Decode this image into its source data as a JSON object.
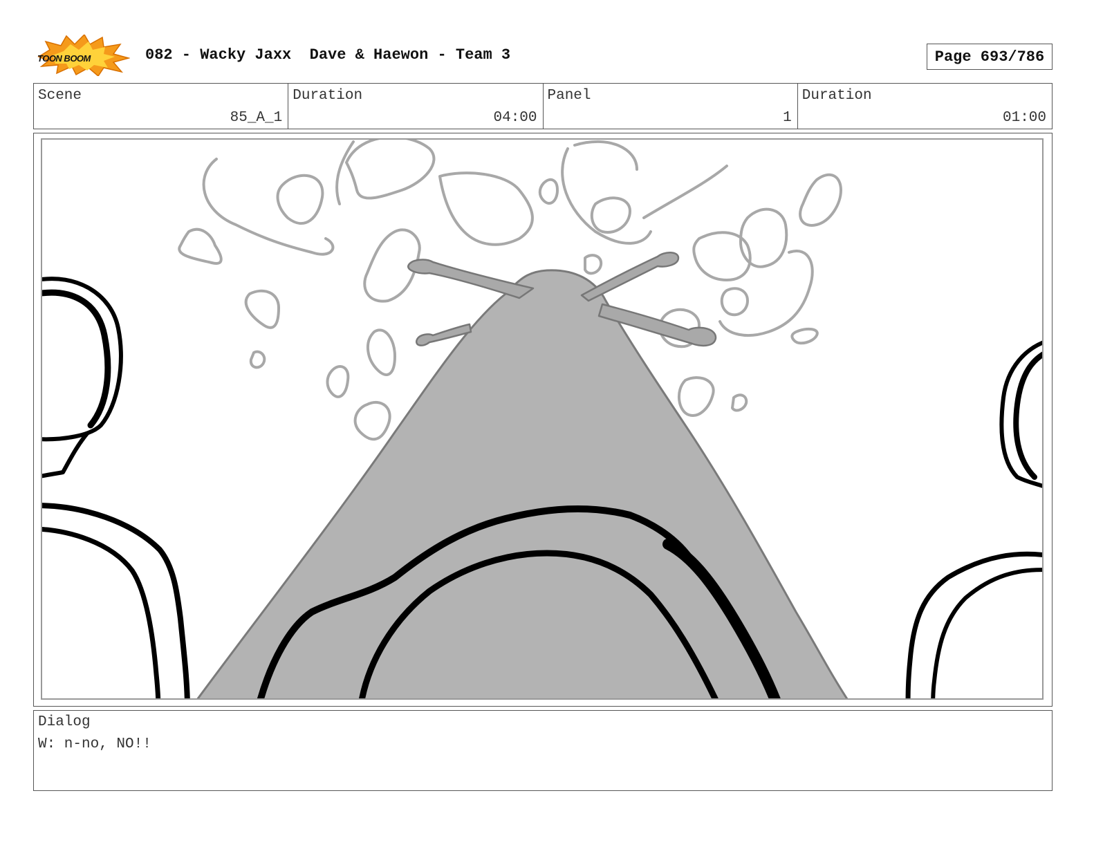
{
  "header": {
    "logo_text": "TOON BOOM",
    "title": "082 - Wacky Jaxx  Dave & Haewon - Team 3",
    "page": "Page 693/786"
  },
  "info": {
    "scene_label": "Scene",
    "scene_value": "85_A_1",
    "duration_label": "Duration",
    "duration_value": "04:00",
    "panel_label": "Panel",
    "panel_value": "1",
    "panel_duration_label": "Duration",
    "panel_duration_value": "01:00"
  },
  "dialog": {
    "label": "Dialog",
    "text": "W: n-no, NO!!"
  },
  "colors": {
    "border": "#555555",
    "frame_inner": "#999999",
    "fill_gray": "#b3b3b3",
    "sketch_gray": "#a8a8a8",
    "logo_orange": "#f59a1b"
  }
}
